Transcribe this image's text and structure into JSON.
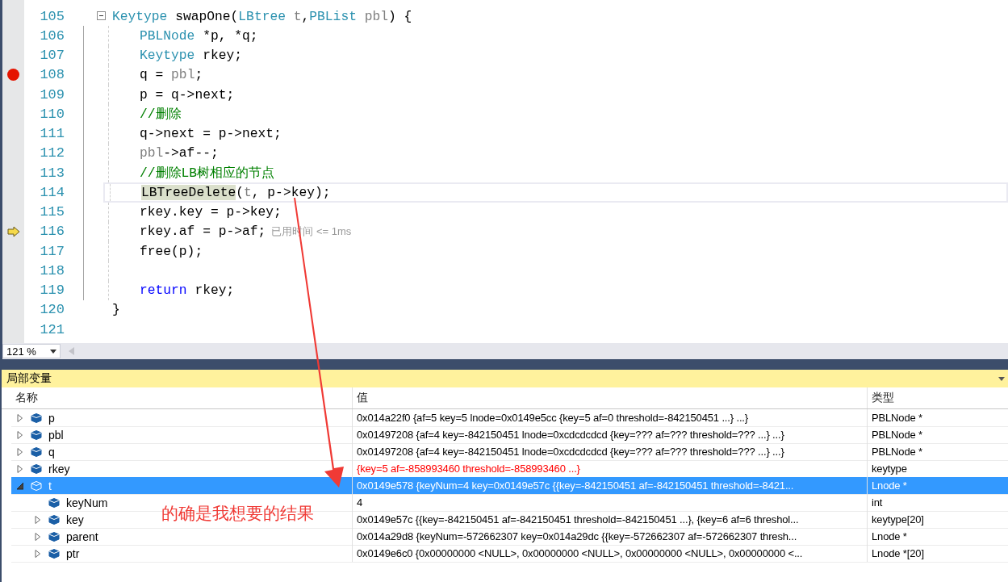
{
  "editor": {
    "lines": [
      {
        "number": "105",
        "breakpoint": false,
        "current": false,
        "caret": false,
        "expanded": true,
        "tokens": [
          {
            "text": "Keytype",
            "kind": "type"
          },
          {
            "text": " swapOne(",
            "kind": "plain"
          },
          {
            "text": "LBtree ",
            "kind": "type"
          },
          {
            "text": "t",
            "kind": "param"
          },
          {
            "text": ",",
            "kind": "plain"
          },
          {
            "text": "PBList ",
            "kind": "type"
          },
          {
            "text": "pbl",
            "kind": "param"
          },
          {
            "text": ") {",
            "kind": "plain"
          }
        ],
        "children": [
          {
            "number": "106",
            "breakpoint": false,
            "current": false,
            "caret": false,
            "tokens": [
              {
                "text": "PBLNode",
                "kind": "type"
              },
              {
                "text": " *p, *q;",
                "kind": "plain"
              }
            ]
          },
          {
            "number": "107",
            "breakpoint": false,
            "current": false,
            "caret": false,
            "tokens": [
              {
                "text": "Keytype",
                "kind": "type"
              },
              {
                "text": " rkey;",
                "kind": "plain"
              }
            ]
          },
          {
            "number": "108",
            "breakpoint": true,
            "current": false,
            "caret": false,
            "tokens": [
              {
                "text": "q = ",
                "kind": "plain"
              },
              {
                "text": "pbl",
                "kind": "param"
              },
              {
                "text": ";",
                "kind": "plain"
              }
            ]
          },
          {
            "number": "109",
            "breakpoint": false,
            "current": false,
            "caret": false,
            "tokens": [
              {
                "text": "p = q->next;",
                "kind": "plain"
              }
            ]
          },
          {
            "number": "110",
            "breakpoint": false,
            "current": false,
            "caret": false,
            "tokens": [
              {
                "text": "//删除",
                "kind": "comment"
              }
            ]
          },
          {
            "number": "111",
            "breakpoint": false,
            "current": false,
            "caret": false,
            "tokens": [
              {
                "text": "q->next = p->next;",
                "kind": "plain"
              }
            ]
          },
          {
            "number": "112",
            "breakpoint": false,
            "current": false,
            "caret": false,
            "tokens": [
              {
                "text": "pbl",
                "kind": "param"
              },
              {
                "text": "->af--;",
                "kind": "plain"
              }
            ]
          },
          {
            "number": "113",
            "breakpoint": false,
            "current": false,
            "caret": false,
            "tokens": [
              {
                "text": "//删除LB树相应的节点",
                "kind": "comment"
              }
            ]
          },
          {
            "number": "114",
            "breakpoint": false,
            "current": false,
            "caret": true,
            "tokens": [
              {
                "text": "LBTreeDelete",
                "kind": "reference"
              },
              {
                "text": "(",
                "kind": "plain"
              },
              {
                "text": "t",
                "kind": "param"
              },
              {
                "text": ", p->key);",
                "kind": "plain"
              }
            ]
          },
          {
            "number": "115",
            "breakpoint": false,
            "current": false,
            "caret": false,
            "tokens": [
              {
                "text": "rkey.key = p->key;",
                "kind": "plain"
              }
            ]
          },
          {
            "number": "116",
            "breakpoint": false,
            "current": true,
            "caret": false,
            "hint": "已用时间 <= 1ms",
            "tokens": [
              {
                "text": "rkey.af = p->af;",
                "kind": "plain"
              }
            ]
          },
          {
            "number": "117",
            "breakpoint": false,
            "current": false,
            "caret": false,
            "tokens": [
              {
                "text": "free(p);",
                "kind": "plain"
              }
            ]
          },
          {
            "number": "118",
            "breakpoint": false,
            "current": false,
            "caret": false
          },
          {
            "number": "119",
            "breakpoint": false,
            "current": false,
            "caret": false,
            "tokens": [
              {
                "text": "return",
                "kind": "keyword"
              },
              {
                "text": " rkey;",
                "kind": "plain"
              }
            ]
          }
        ]
      },
      {
        "number": "120",
        "breakpoint": false,
        "current": false,
        "caret": false,
        "tokens": [
          {
            "text": "}",
            "kind": "plain"
          }
        ]
      },
      {
        "number": "121",
        "breakpoint": false,
        "current": false,
        "caret": false
      }
    ],
    "zoom": "121 %"
  },
  "locals": {
    "title": "局部变量",
    "columns": [
      "名称",
      "值",
      "类型"
    ],
    "rows": [
      {
        "name": "p",
        "value": "0x014a22f0 {af=5 key=5 lnode=0x0149e5cc {key=5 af=0 threshold=-842150451 ...} ...}",
        "type": "PBLNode *",
        "expandable": true,
        "expanded": false,
        "changed": false,
        "selected": false
      },
      {
        "name": "pbl",
        "value": "0x01497208 {af=4 key=-842150451 lnode=0xcdcdcdcd {key=??? af=??? threshold=??? ...} ...}",
        "type": "PBLNode *",
        "expandable": true,
        "expanded": false,
        "changed": false,
        "selected": false
      },
      {
        "name": "q",
        "value": "0x01497208 {af=4 key=-842150451 lnode=0xcdcdcdcd {key=??? af=??? threshold=??? ...} ...}",
        "type": "PBLNode *",
        "expandable": true,
        "expanded": false,
        "changed": false,
        "selected": false
      },
      {
        "name": "rkey",
        "value": "{key=5 af=-858993460 threshold=-858993460 ...}",
        "type": "keytype",
        "expandable": true,
        "expanded": false,
        "changed": true,
        "selected": false
      },
      {
        "name": "t",
        "value": "0x0149e578 {keyNum=4 key=0x0149e57c {{key=-842150451 af=-842150451 threshold=-8421...",
        "type": "Lnode *",
        "expandable": true,
        "expanded": true,
        "changed": false,
        "selected": true,
        "children": [
          {
            "name": "keyNum",
            "value": "4",
            "type": "int",
            "expandable": false,
            "changed": false,
            "selected": false
          },
          {
            "name": "key",
            "value": "0x0149e57c {{key=-842150451 af=-842150451 threshold=-842150451 ...}, {key=6 af=6 threshol...",
            "type": "keytype[20]",
            "expandable": true,
            "expanded": false,
            "changed": false,
            "selected": false
          },
          {
            "name": "parent",
            "value": "0x014a29d8 {keyNum=-572662307 key=0x014a29dc {{key=-572662307 af=-572662307 thresh...",
            "type": "Lnode *",
            "expandable": true,
            "expanded": false,
            "changed": false,
            "selected": false
          },
          {
            "name": "ptr",
            "value": "0x0149e6c0 {0x00000000 <NULL>, 0x00000000 <NULL>, 0x00000000 <NULL>, 0x00000000 <...",
            "type": "Lnode *[20]",
            "expandable": true,
            "expanded": false,
            "changed": false,
            "selected": false
          }
        ]
      }
    ]
  },
  "annotation": {
    "text": "的确是我想要的结果"
  }
}
